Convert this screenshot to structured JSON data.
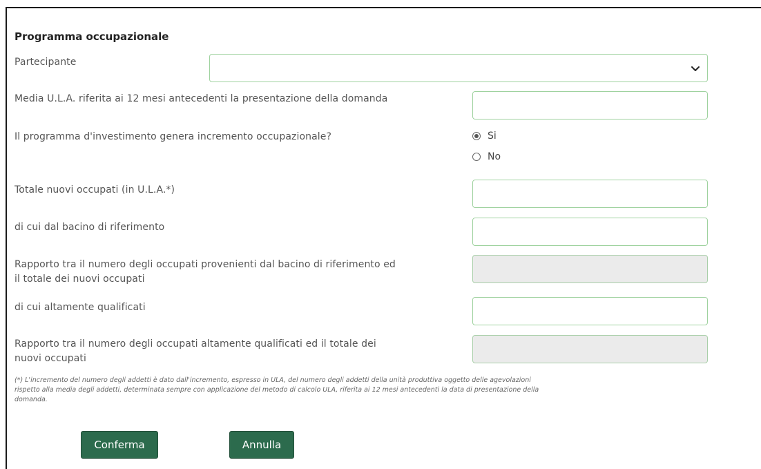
{
  "form": {
    "title": "Programma occupazionale",
    "participant_label": "Partecipante",
    "participant_value": "",
    "media_ula_label": "Media U.L.A. riferita ai 12 mesi antecedenti la presentazione della domanda",
    "media_ula_value": "",
    "incremento_label": "Il programma d'investimento genera incremento occupazionale?",
    "incremento_options": [
      "Si",
      "No"
    ],
    "incremento_selected": "Si",
    "totale_label": "Totale nuovi occupati (in U.L.A.*)",
    "totale_value": "",
    "bacino_label": "di cui dal bacino di riferimento",
    "bacino_value": "",
    "rapporto_bacino_label_line1": "Rapporto tra il numero degli occupati provenienti dal bacino di riferimento ed",
    "rapporto_bacino_label_line2": "il totale dei nuovi occupati",
    "rapporto_bacino_value": "",
    "qualificati_label": "di cui altamente qualificati",
    "qualificati_value": "",
    "rapporto_qualificati_label_line1": "Rapporto tra il numero degli occupati altamente qualificati ed il totale dei",
    "rapporto_qualificati_label_line2": "nuovi occupati",
    "rapporto_qualificati_value": "",
    "footnote_line1": "(*) L'incremento del numero degli addetti è dato dall'incremento, espresso in ULA, del numero degli addetti della unità produttiva oggetto delle agevolazioni",
    "footnote_line2": "rispetto alla media degli addetti, determinata sempre con applicazione del metodo di calcolo ULA, riferita ai 12 mesi antecedenti la data di presentazione della",
    "footnote_line3": "domanda."
  },
  "buttons": {
    "confirm_label": "Conferma",
    "cancel_label": "Annulla"
  },
  "colors": {
    "button_bg": "#2c6b4d",
    "field_border": "#9fd29f",
    "disabled_bg": "#ebebeb"
  },
  "icons": {
    "select": "chevron-down-icon"
  }
}
